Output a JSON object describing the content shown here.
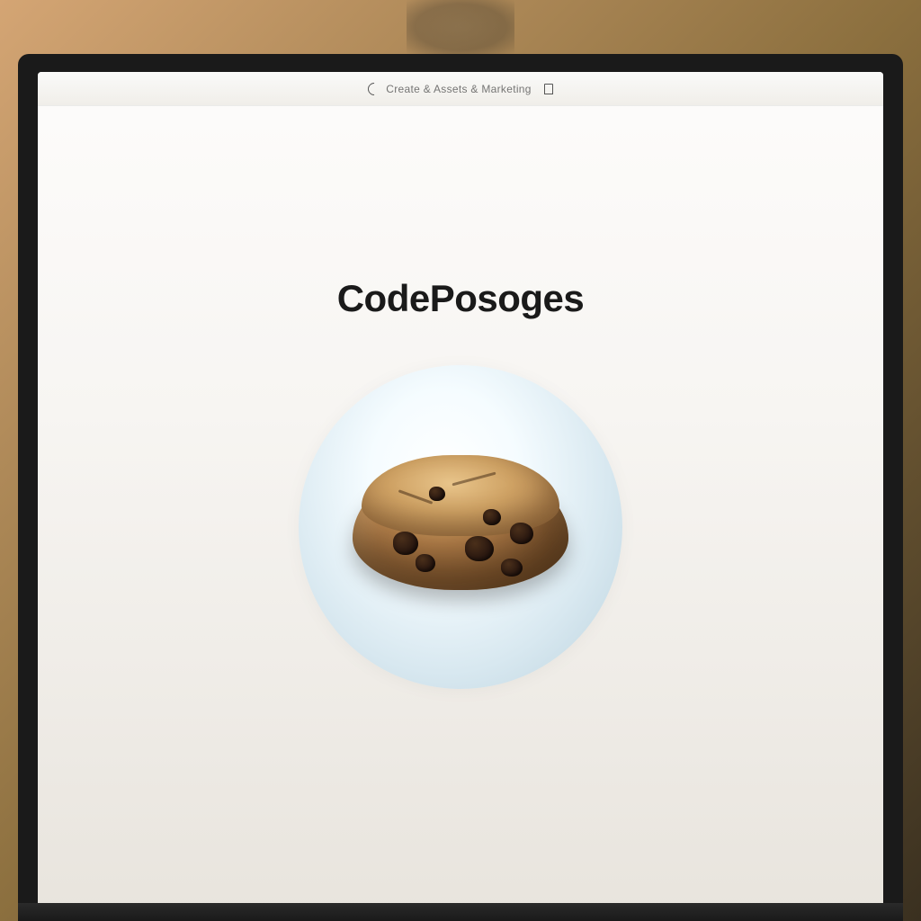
{
  "toolbar": {
    "url_text": "Create & Assets & Marketing"
  },
  "main": {
    "title": "CodePosoges",
    "image_name": "chocolate-chip-cookie"
  }
}
